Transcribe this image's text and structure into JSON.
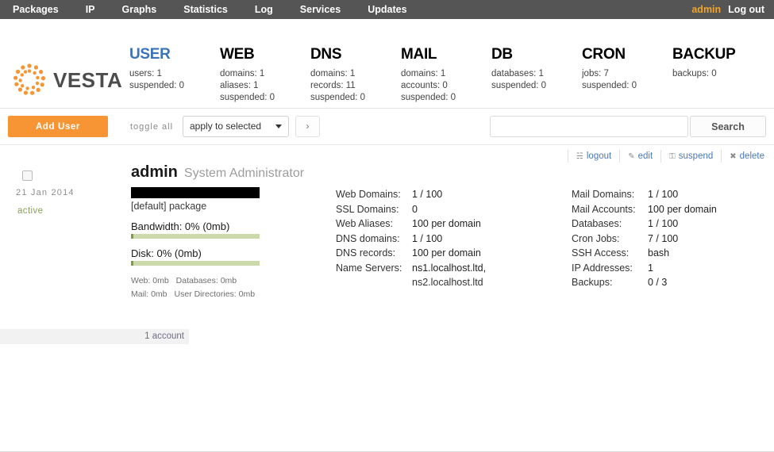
{
  "topnav": {
    "items": [
      {
        "label": "Packages"
      },
      {
        "label": "IP"
      },
      {
        "label": "Graphs"
      },
      {
        "label": "Statistics"
      },
      {
        "label": "Log"
      },
      {
        "label": "Services"
      },
      {
        "label": "Updates"
      }
    ],
    "user": "admin",
    "logout": "Log out",
    "user_color": "#f0a52a",
    "bg_color": "#555555"
  },
  "logo": {
    "text": "VESTA",
    "icon": "vesta-dots-logo",
    "color": "#f79434"
  },
  "stats": [
    {
      "title": "USER",
      "active": true,
      "lines": [
        "users: 1",
        "suspended: 0"
      ]
    },
    {
      "title": "WEB",
      "active": false,
      "lines": [
        "domains: 1",
        "aliases: 1",
        "suspended: 0"
      ]
    },
    {
      "title": "DNS",
      "active": false,
      "lines": [
        "domains: 1",
        "records: 11",
        "suspended: 0"
      ]
    },
    {
      "title": "MAIL",
      "active": false,
      "lines": [
        "domains: 1",
        "accounts: 0",
        "suspended: 0"
      ]
    },
    {
      "title": "DB",
      "active": false,
      "lines": [
        "databases: 1",
        "suspended: 0"
      ]
    },
    {
      "title": "CRON",
      "active": false,
      "lines": [
        "jobs: 7",
        "suspended: 0"
      ]
    },
    {
      "title": "BACKUP",
      "active": false,
      "lines": [
        "backups: 0"
      ]
    }
  ],
  "toolbar": {
    "add_label": "Add User",
    "toggle_all": "toggle all",
    "apply_selected": "apply to selected",
    "go_label": "›",
    "search_value": "",
    "search_placeholder": "",
    "search_label": "Search"
  },
  "actions": [
    {
      "icon": "☵",
      "label": "logout",
      "name": "logout"
    },
    {
      "icon": "✎",
      "label": "edit",
      "name": "edit"
    },
    {
      "icon": "⚿",
      "label": "suspend",
      "name": "suspend"
    },
    {
      "icon": "✖",
      "label": "delete",
      "name": "delete"
    }
  ],
  "record": {
    "date": "21 Jan 2014",
    "status": "active",
    "username": "admin",
    "fullname": "System Administrator",
    "package": "[default] package",
    "bandwidth_label": "Bandwidth: 0% (0mb)",
    "bandwidth_percent": 0,
    "disk_label": "Disk: 0% (0mb)",
    "disk_percent": 0,
    "usage": [
      {
        "label": "Web: 0mb",
        "label2": "Databases: 0mb"
      },
      {
        "label": "Mail: 0mb",
        "label2": "User Directories: 0mb"
      }
    ],
    "details_mid": [
      {
        "key": "Web Domains:",
        "value": "1 / 100"
      },
      {
        "key": "SSL Domains:",
        "value": "0"
      },
      {
        "key": "Web Aliases:",
        "value": "100 per domain"
      },
      {
        "key": "DNS domains:",
        "value": "1 / 100"
      },
      {
        "key": "DNS records:",
        "value": "100 per domain"
      },
      {
        "key": "Name Servers:",
        "value": "ns1.localhost.ltd,"
      }
    ],
    "nameserver2": "ns2.localhost.ltd",
    "details_right": [
      {
        "key": "Mail Domains:",
        "value": "1 / 100"
      },
      {
        "key": "Mail Accounts:",
        "value": "100 per domain"
      },
      {
        "key": "Databases:",
        "value": "1 / 100"
      },
      {
        "key": "Cron Jobs:",
        "value": "7 / 100"
      },
      {
        "key": "SSH Access:",
        "value": "bash"
      },
      {
        "key": "IP Addresses:",
        "value": "1"
      },
      {
        "key": "Backups:",
        "value": "0 / 3"
      }
    ]
  },
  "footer": {
    "count": "1 account"
  }
}
